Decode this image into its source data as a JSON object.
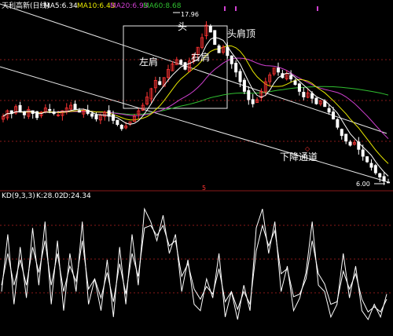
{
  "colors": {
    "background": "#000000",
    "up": "#ff3333",
    "down": "#ffffff",
    "ma5": "#ffffff",
    "ma10": "#e8e800",
    "ma20": "#d040d0",
    "ma60": "#30c030",
    "grid": "#8a1a1a",
    "annotation": "#ffffff",
    "kdj_k": "#ffffff",
    "kdj_d": "#ffffff"
  },
  "header": {
    "title": "天利高新(日线)",
    "ma5": "MA5:6.34",
    "ma10": "MA10:6.43",
    "ma20": "MA20:6.93",
    "ma60": "MA60:8.68"
  },
  "annotations": {
    "head": "头",
    "left_shoulder": "左肩",
    "right_shoulder": "右肩",
    "pattern": "头肩顶",
    "channel": "下降通道",
    "high_price": "17.96",
    "low_price": "6.00",
    "divider_mark": "5"
  },
  "kd_header": {
    "label": "KD(9,3,3)",
    "k": "K:28.02",
    "d": "D:24.34"
  },
  "chart_data": [
    {
      "type": "candlestick",
      "title": "天利高新(日线)",
      "series_labels": [
        "MA5:6.34",
        "MA10:6.43",
        "MA20:6.93",
        "MA60:8.68"
      ],
      "approx_close": [
        10.8,
        11.2,
        11.0,
        11.5,
        11.1,
        10.9,
        11.3,
        11.0,
        10.7,
        11.1,
        11.4,
        11.2,
        11.0,
        10.9,
        11.2,
        11.4,
        11.6,
        11.3,
        11.1,
        11.2,
        11.0,
        10.8,
        10.6,
        10.9,
        11.1,
        10.8,
        10.5,
        10.2,
        9.9,
        10.1,
        10.4,
        10.8,
        11.2,
        11.6,
        12.2,
        12.8,
        13.4,
        13.1,
        13.6,
        14.2,
        14.6,
        14.9,
        14.6,
        14.2,
        14.8,
        15.3,
        15.8,
        16.5,
        17.4,
        16.9,
        16.0,
        15.4,
        15.8,
        15.2,
        14.6,
        14.0,
        13.3,
        12.6,
        12.0,
        11.7,
        12.0,
        12.6,
        13.3,
        13.8,
        14.3,
        14.0,
        13.6,
        13.9,
        13.5,
        13.1,
        12.6,
        12.2,
        12.5,
        12.1,
        11.7,
        11.9,
        11.5,
        11.1,
        10.6,
        10.0,
        9.4,
        9.0,
        8.7,
        8.9,
        8.4,
        7.9,
        7.5,
        7.1,
        6.7,
        6.4,
        6.1,
        6.0
      ],
      "high_marker": 17.96,
      "low_marker": 6.0,
      "ma_periods": [
        5,
        10,
        20,
        60
      ]
    },
    {
      "type": "line",
      "title": "KD(9,3,3)",
      "series": [
        {
          "name": "K:28.02",
          "values": [
            30,
            75,
            20,
            65,
            25,
            80,
            35,
            85,
            20,
            70,
            15,
            60,
            30,
            85,
            20,
            40,
            15,
            55,
            10,
            65,
            20,
            75,
            35,
            95,
            85,
            70,
            90,
            60,
            75,
            30,
            55,
            20,
            15,
            40,
            25,
            60,
            10,
            30,
            8,
            35,
            15,
            80,
            95,
            60,
            85,
            30,
            50,
            15,
            25,
            45,
            85,
            35,
            30,
            10,
            20,
            60,
            25,
            50,
            15,
            8,
            20,
            10,
            28
          ]
        },
        {
          "name": "D:24.34",
          "values": [
            35,
            60,
            35,
            55,
            35,
            65,
            45,
            70,
            35,
            60,
            30,
            50,
            38,
            70,
            32,
            40,
            25,
            45,
            22,
            52,
            28,
            60,
            42,
            80,
            82,
            74,
            82,
            66,
            70,
            42,
            52,
            32,
            24,
            34,
            28,
            48,
            22,
            30,
            16,
            30,
            20,
            62,
            82,
            66,
            78,
            44,
            48,
            26,
            28,
            40,
            70,
            44,
            36,
            20,
            22,
            46,
            32,
            44,
            24,
            14,
            18,
            14,
            24
          ]
        }
      ],
      "ylim": [
        0,
        100
      ]
    }
  ]
}
